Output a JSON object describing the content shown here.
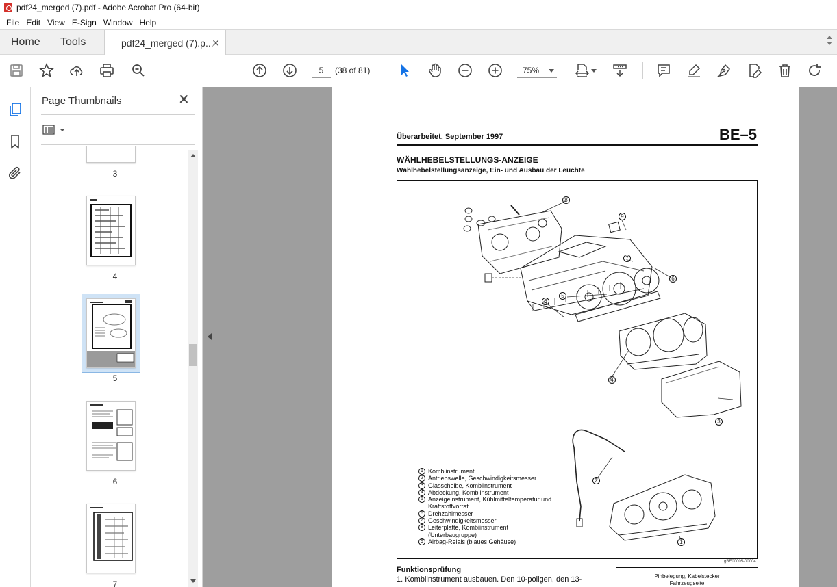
{
  "window": {
    "title": "pdf24_merged (7).pdf - Adobe Acrobat Pro (64-bit)"
  },
  "menu": [
    "File",
    "Edit",
    "View",
    "E-Sign",
    "Window",
    "Help"
  ],
  "tabs": {
    "home": "Home",
    "tools": "Tools",
    "document": "pdf24_merged (7).p..."
  },
  "toolbar": {
    "page_number": "5",
    "page_count": "(38 of 81)",
    "zoom": "75%"
  },
  "thumbnail_panel": {
    "title": "Page Thumbnails",
    "pages": [
      {
        "label": "3"
      },
      {
        "label": "4"
      },
      {
        "label": "5",
        "selected": true
      },
      {
        "label": "6"
      },
      {
        "label": "7"
      }
    ]
  },
  "document_page": {
    "revised": "Überarbeitet, September 1997",
    "code": "BE–5",
    "title": "WÄHLHEBELSTELLUNGS-ANZEIGE",
    "subtitle": "Wählhebelstellungsanzeige, Ein- und Ausbau der Leuchte",
    "callouts": [
      "1",
      "2",
      "3",
      "4",
      "5",
      "6",
      "7",
      "8",
      "9"
    ],
    "legend": [
      {
        "num": "1",
        "text": "Kombiinstrument"
      },
      {
        "num": "2",
        "text": "Antriebswelle, Geschwindigkeitsmesser"
      },
      {
        "num": "3",
        "text": "Glasscheibe, Kombiinstrument"
      },
      {
        "num": "4",
        "text": "Abdeckung, Kombiinstrument"
      },
      {
        "num": "5",
        "text": "Anzeigeinstrument, Kühlmitteltemperatur und Kraftstoffvorrat"
      },
      {
        "num": "6",
        "text": "Drehzahlmesser"
      },
      {
        "num": "7",
        "text": "Geschwindigkeitsmesser"
      },
      {
        "num": "8",
        "text": "Leiterplatte, Kombiinstrument (Unterbaugruppe)"
      },
      {
        "num": "9",
        "text": "Airbag-Relais (blaues Gehäuse)"
      }
    ],
    "figure_code": "gBE00005-00004",
    "section_title": "Funktionsprüfung",
    "step_1": "1.  Kombiinstrument ausbauen. Den 10-poligen, den 13-",
    "pin_box_line1": "Pinbelegung, Kabelstecker",
    "pin_box_line2": "Fahrzeugseite"
  }
}
